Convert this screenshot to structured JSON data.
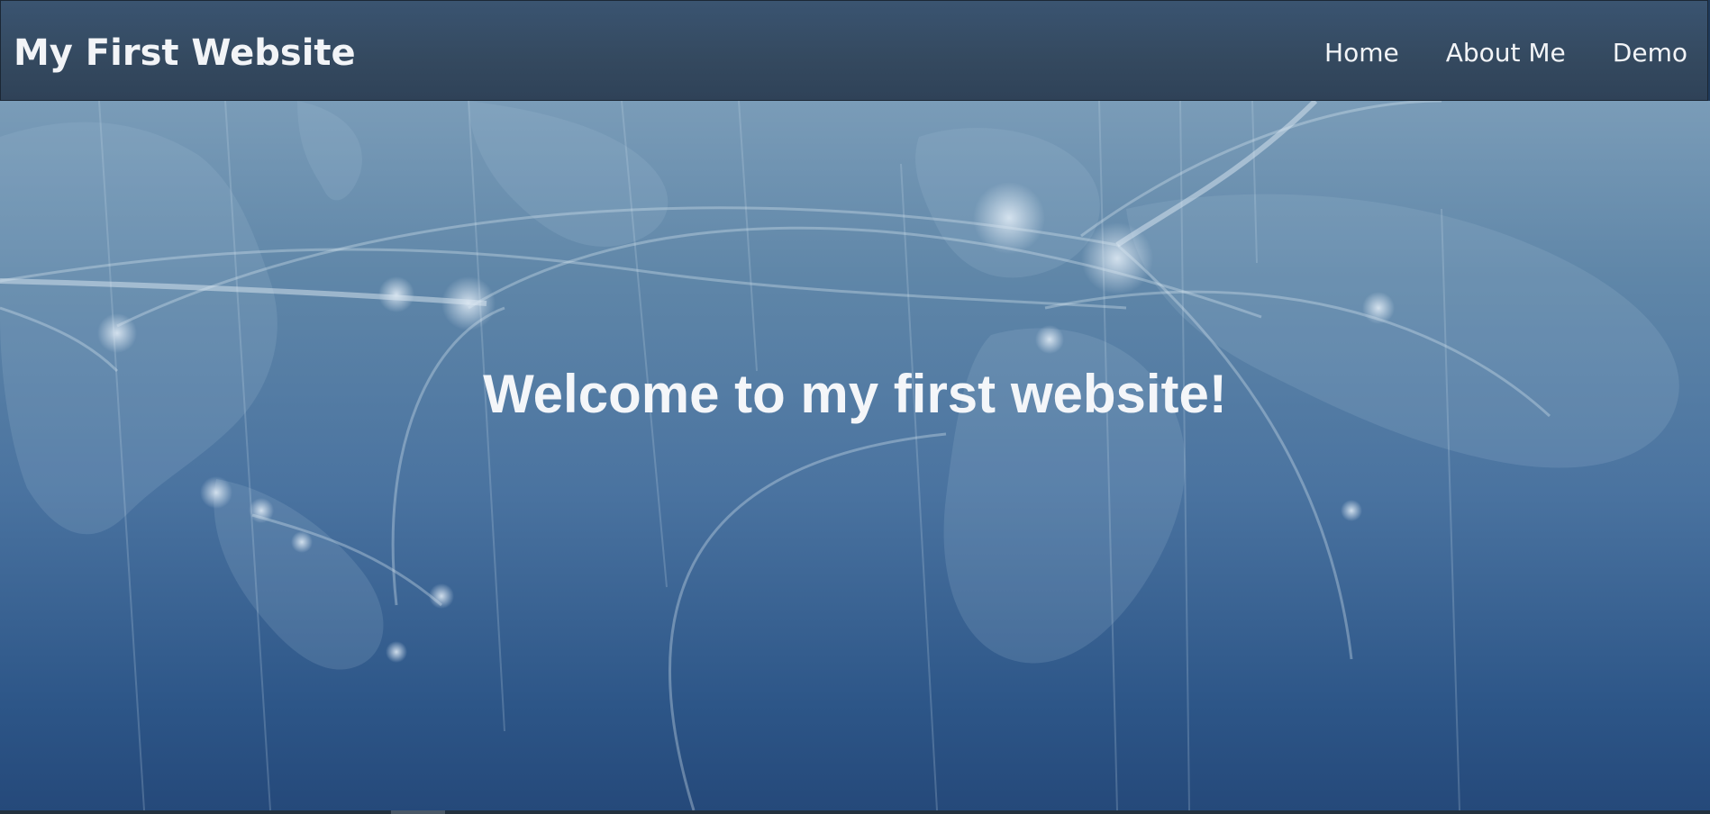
{
  "navbar": {
    "brand": "My First Website",
    "links": [
      {
        "label": "Home"
      },
      {
        "label": "About Me"
      },
      {
        "label": "Demo"
      }
    ]
  },
  "hero": {
    "heading": "Welcome to my first website!",
    "background": "world-network-map-image"
  },
  "colors": {
    "navbar_bg": "#34495f",
    "hero_top": "#7a9cb8",
    "hero_bottom": "#25497a",
    "text": "#f2f4f7"
  }
}
